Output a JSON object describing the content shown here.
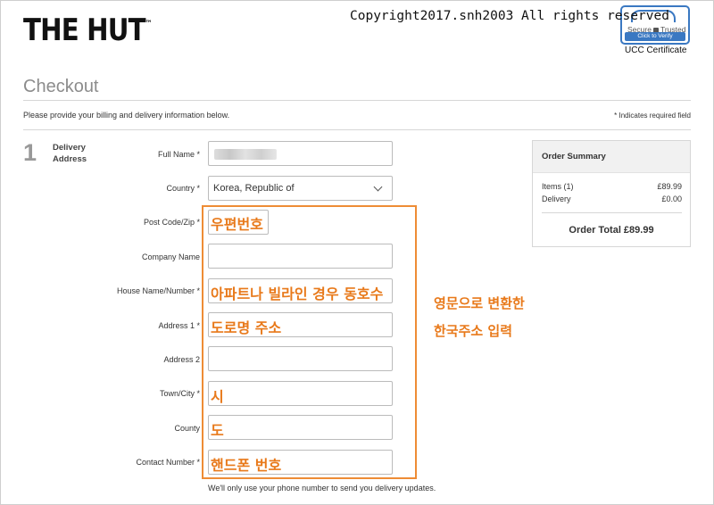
{
  "header": {
    "logo": "THE HUT",
    "logo_tm": "™",
    "copyright": "Copyright2017.snh2003 All rights reserved",
    "badge": {
      "secure": "Secure",
      "trusted": "Trusted",
      "verify": "Click to Verify",
      "caption": "UCC Certificate"
    }
  },
  "page": {
    "title": "Checkout",
    "intro": "Please provide your billing and delivery information below.",
    "required_note": "* Indicates required field"
  },
  "step": {
    "number": "1",
    "label": "Delivery Address"
  },
  "form": {
    "full_name_label": "Full Name *",
    "country_label": "Country *",
    "country_value": "Korea, Republic of",
    "postcode_label": "Post Code/Zip *",
    "company_label": "Company Name",
    "house_label": "House Name/Number *",
    "address1_label": "Address 1 *",
    "address2_label": "Address 2",
    "town_label": "Town/City *",
    "county_label": "County",
    "phone_label": "Contact Number *",
    "phone_help": "We'll only use your phone number to send you delivery updates."
  },
  "annotations": {
    "postcode": "우편번호",
    "house": "아파트나 빌라인 경우 동호수",
    "address1": "도로명 주소",
    "town": "시",
    "county": "도",
    "phone": "핸드폰 번호",
    "note_line1": "영문으로 변환한",
    "note_line2": "한국주소 입력",
    "accent_color": "#e8791a"
  },
  "summary": {
    "title": "Order Summary",
    "items_label": "Items (1)",
    "items_value": "£89.99",
    "delivery_label": "Delivery",
    "delivery_value": "£0.00",
    "total": "Order Total £89.99"
  }
}
